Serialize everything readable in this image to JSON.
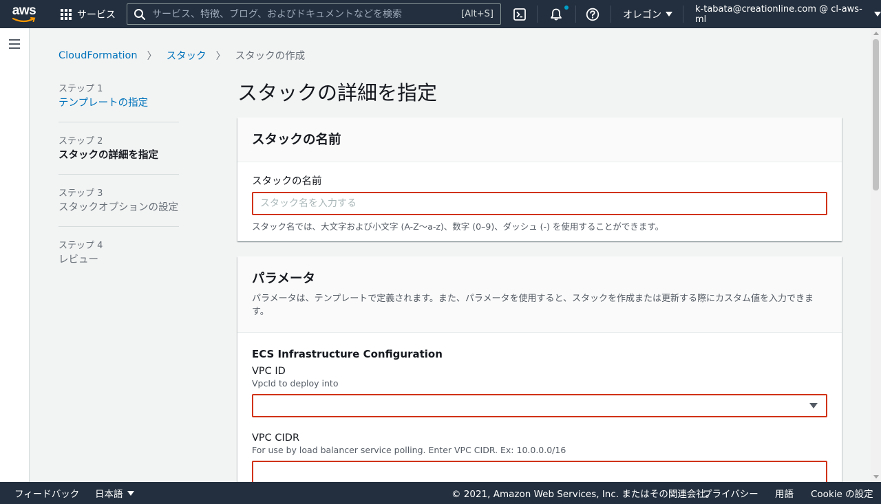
{
  "topnav": {
    "logo_text": "aws",
    "services_label": "サービス",
    "search_placeholder": "サービス、特徴、ブログ、およびドキュメントなどを検索",
    "search_shortcut": "[Alt+S]",
    "region_label": "オレゴン",
    "account_label": "k-tabata@creationline.com @ cl-aws-ml"
  },
  "breadcrumb": {
    "items": [
      "CloudFormation",
      "スタック"
    ],
    "current": "スタックの作成"
  },
  "steps": [
    {
      "num": "ステップ 1",
      "label": "テンプレートの指定"
    },
    {
      "num": "ステップ 2",
      "label": "スタックの詳細を指定"
    },
    {
      "num": "ステップ 3",
      "label": "スタックオプションの設定"
    },
    {
      "num": "ステップ 4",
      "label": "レビュー"
    }
  ],
  "page_title": "スタックの詳細を指定",
  "stack_name_panel": {
    "title": "スタックの名前",
    "field_label": "スタックの名前",
    "placeholder": "スタック名を入力する",
    "value": "",
    "constraint": "スタック名では、大文字および小文字 (A-Z〜a-z)、数字 (0–9)、ダッシュ (-) を使用することができます。"
  },
  "params_panel": {
    "title": "パラメータ",
    "description": "パラメータは、テンプレートで定義されます。また、パラメータを使用すると、スタックを作成または更新する際にカスタム値を入力できます。",
    "section_title": "ECS Infrastructure Configuration",
    "vpc_id": {
      "label": "VPC ID",
      "desc": "VpcId to deploy into",
      "value": ""
    },
    "vpc_cidr": {
      "label": "VPC CIDR",
      "desc": "For use by load balancer service polling. Enter VPC CIDR. Ex: 10.0.0.0/16",
      "value": ""
    }
  },
  "footer": {
    "feedback": "フィードバック",
    "language": "日本語",
    "copyright": "© 2021, Amazon Web Services, Inc. またはその関連会社。",
    "privacy": "プライバシー",
    "terms": "用語",
    "cookie": "Cookie の設定"
  },
  "colors": {
    "nav_bg": "#232f3e",
    "link": "#0073bb",
    "error_border": "#d13212",
    "notif_dot": "#00a1c9"
  }
}
